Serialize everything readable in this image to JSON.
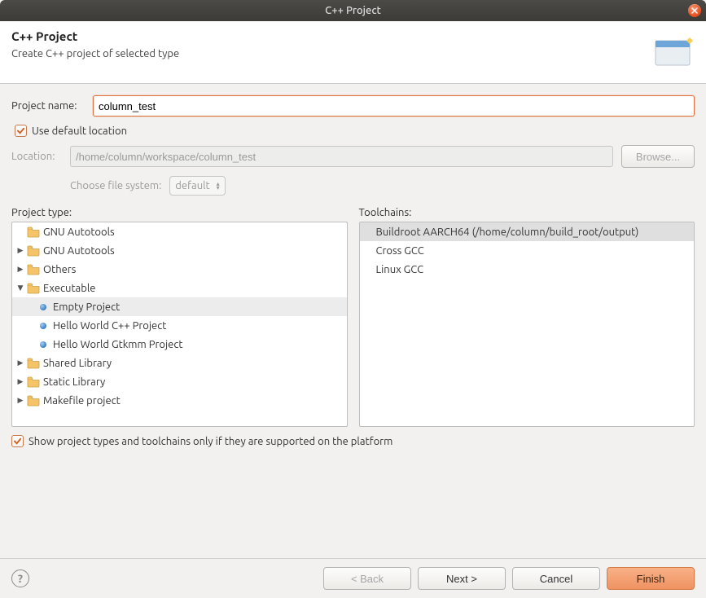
{
  "window": {
    "title": "C++ Project"
  },
  "banner": {
    "heading": "C++ Project",
    "subheading": "Create C++ project of selected type"
  },
  "form": {
    "project_name_label": "Project name:",
    "project_name_value": "column_test",
    "use_default_location_label": "Use default location",
    "use_default_location_checked": true,
    "location_label": "Location:",
    "location_value": "/home/column/workspace/column_test",
    "browse_label": "Browse...",
    "choose_fs_label": "Choose file system:",
    "fs_value": "default"
  },
  "panels": {
    "project_type_label": "Project type:",
    "toolchains_label": "Toolchains:"
  },
  "project_types": [
    {
      "kind": "folder",
      "label": "GNU Autotools",
      "indent": 0,
      "expander": "none",
      "selected": false
    },
    {
      "kind": "folder",
      "label": "GNU Autotools",
      "indent": 0,
      "expander": "closed",
      "selected": false
    },
    {
      "kind": "folder",
      "label": "Others",
      "indent": 0,
      "expander": "closed",
      "selected": false
    },
    {
      "kind": "folder",
      "label": "Executable",
      "indent": 0,
      "expander": "open",
      "selected": false
    },
    {
      "kind": "leaf",
      "label": "Empty Project",
      "indent": 1,
      "expander": "none",
      "selected": true
    },
    {
      "kind": "leaf",
      "label": "Hello World C++ Project",
      "indent": 1,
      "expander": "none",
      "selected": false
    },
    {
      "kind": "leaf",
      "label": "Hello World Gtkmm Project",
      "indent": 1,
      "expander": "none",
      "selected": false
    },
    {
      "kind": "folder",
      "label": "Shared Library",
      "indent": 0,
      "expander": "closed",
      "selected": false
    },
    {
      "kind": "folder",
      "label": "Static Library",
      "indent": 0,
      "expander": "closed",
      "selected": false
    },
    {
      "kind": "folder",
      "label": "Makefile project",
      "indent": 0,
      "expander": "closed",
      "selected": false
    }
  ],
  "toolchains": [
    {
      "label": "Buildroot AARCH64 (/home/column/build_root/output)",
      "selected": true
    },
    {
      "label": "Cross GCC",
      "selected": false
    },
    {
      "label": "Linux GCC",
      "selected": false
    }
  ],
  "filter": {
    "show_supported_label": "Show project types and toolchains only if they are supported on the platform",
    "show_supported_checked": true
  },
  "footer": {
    "back": "< Back",
    "next": "Next >",
    "cancel": "Cancel",
    "finish": "Finish"
  }
}
